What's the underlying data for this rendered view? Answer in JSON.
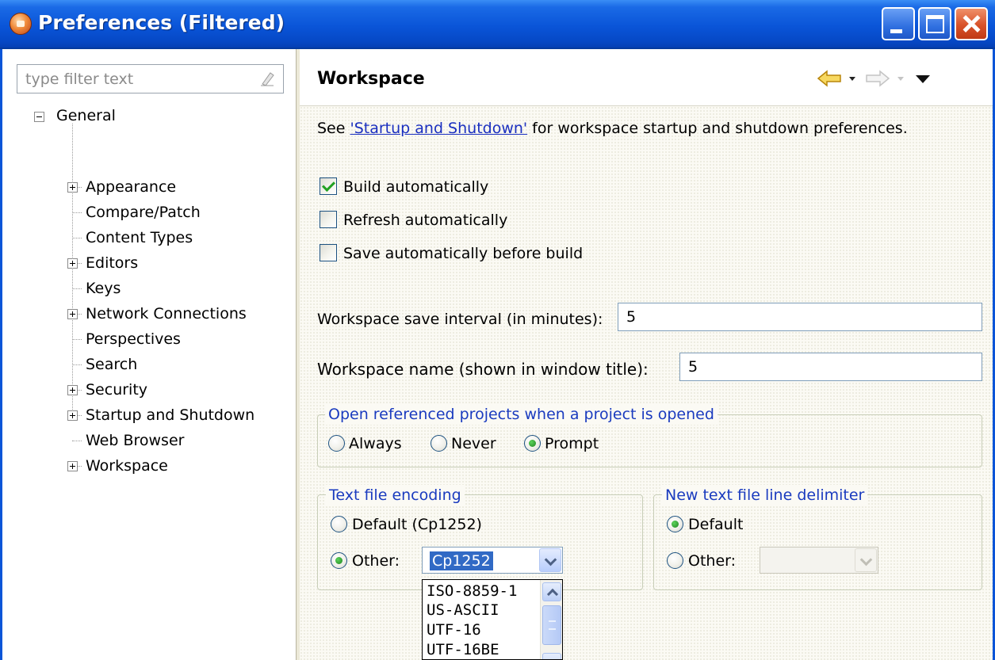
{
  "window": {
    "title": "Preferences (Filtered)"
  },
  "filter": {
    "placeholder": "type filter text",
    "value": ""
  },
  "tree": {
    "root": "General",
    "items": [
      {
        "label": "Appearance",
        "expandable": true
      },
      {
        "label": "Compare/Patch",
        "expandable": false
      },
      {
        "label": "Content Types",
        "expandable": false
      },
      {
        "label": "Editors",
        "expandable": true
      },
      {
        "label": "Keys",
        "expandable": false
      },
      {
        "label": "Network Connections",
        "expandable": true
      },
      {
        "label": "Perspectives",
        "expandable": false
      },
      {
        "label": "Search",
        "expandable": false
      },
      {
        "label": "Security",
        "expandable": true
      },
      {
        "label": "Startup and Shutdown",
        "expandable": true
      },
      {
        "label": "Web Browser",
        "expandable": false
      },
      {
        "label": "Workspace",
        "expandable": true
      }
    ]
  },
  "page": {
    "title": "Workspace",
    "intro_prefix": "See ",
    "intro_link": "'Startup and Shutdown'",
    "intro_suffix": " for workspace startup and shutdown preferences.",
    "build_automatically": {
      "label": "Build automatically",
      "checked": true
    },
    "refresh_automatically": {
      "label": "Refresh automatically",
      "checked": false
    },
    "save_before_build": {
      "label": "Save automatically before build",
      "checked": false
    },
    "save_interval": {
      "label": "Workspace save interval (in minutes):",
      "value": "5"
    },
    "workspace_name": {
      "label": "Workspace name (shown in window title):",
      "value": "5"
    },
    "open_projects": {
      "title": "Open referenced projects when a project is opened",
      "options": [
        "Always",
        "Never",
        "Prompt"
      ],
      "selected": "Prompt"
    },
    "encoding": {
      "title": "Text file encoding",
      "default_label": "Default (Cp1252)",
      "other_label": "Other:",
      "selected": "Other",
      "other_value": "Cp1252",
      "dropdown_options": [
        "ISO-8859-1",
        "US-ASCII",
        "UTF-16",
        "UTF-16BE"
      ]
    },
    "line_delimiter": {
      "title": "New text file line delimiter",
      "default_label": "Default",
      "other_label": "Other:",
      "selected": "Default",
      "other_value": ""
    }
  },
  "colors": {
    "titlebar": "#0a55d8",
    "link": "#1a2fbf",
    "group_title": "#1a3bbf",
    "selection": "#316ac5",
    "check": "#21a121"
  }
}
